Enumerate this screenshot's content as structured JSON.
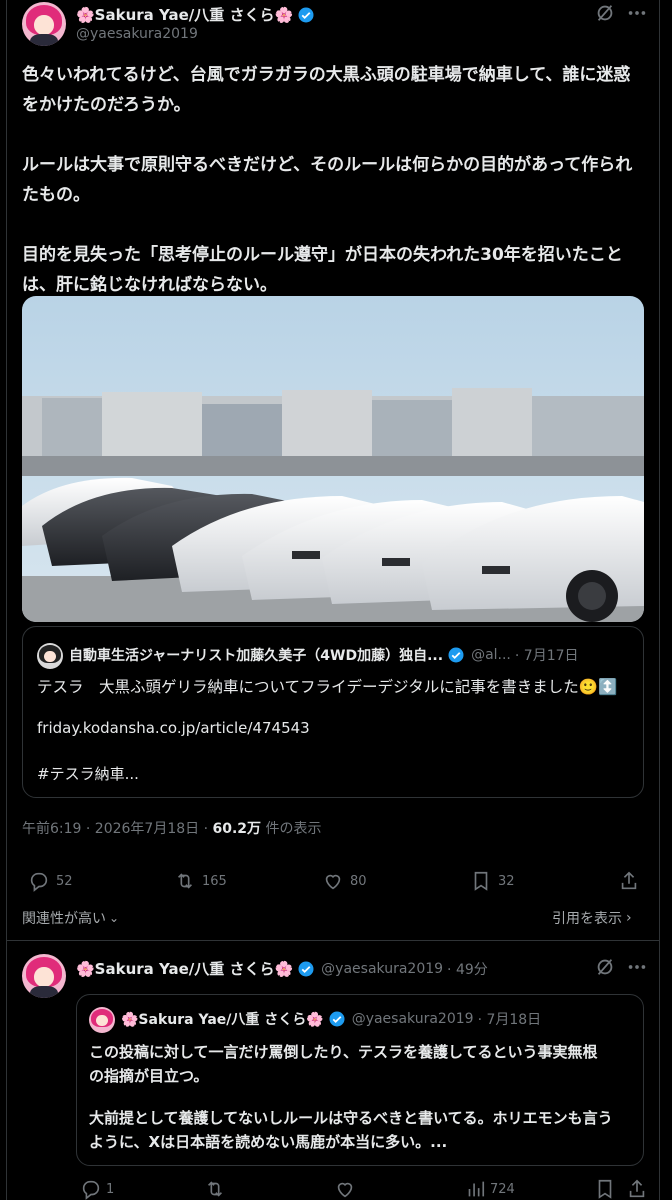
{
  "main_tweet": {
    "author_name": "🌸Sakura Yae/八重 さくら🌸",
    "handle": "@yaesakura2019",
    "paragraphs": [
      "色々いわれてるけど、台風でガラガラの大黒ふ頭の駐車場で納車して、誰に迷惑をかけたのだろうか。",
      "ルールは大事で原則守るべきだけど、そのルールは何らかの目的があって作られたもの。",
      "目的を見失った「思考停止のルール遵守」が日本の失われた30年を招いたことは、肝に銘じなければならない。"
    ],
    "timestamp": "午前6:19 · 2026年7月18日 · ",
    "views_count": "60.2万",
    "views_label": " 件の表示",
    "actions": {
      "replies": "52",
      "retweets": "165",
      "likes": "80",
      "bookmarks": "32"
    },
    "sort_label": "関連性が高い",
    "quotes_link": "引用を表示"
  },
  "quoted_tweet": {
    "author_name": "自動車生活ジャーナリスト加藤久美子（4WD加藤）独自...",
    "handle": "@al...",
    "date": "· 7月17日",
    "line1": "テスラ　大黒ふ頭ゲリラ納車についてフライデーデジタルに記事を書きました🙂↕️",
    "link": "friday.kodansha.co.jp/article/474543",
    "hashtag": "#テスラ納車..."
  },
  "reply_tweet": {
    "author_name": "🌸Sakura Yae/八重 さくら🌸",
    "handle": "@yaesakura2019",
    "time": "· 49分",
    "quoted": {
      "author_name": "🌸Sakura Yae/八重 さくら🌸",
      "handle": "@yaesakura2019",
      "date": "· 7月18日",
      "text_lines": [
        "この投稿に対して一言だけ罵倒したり、テスラを養護してるという事実無根",
        "の指摘が目立つ。",
        "",
        "大前提として養護してないしルールは守るべきと書いてる。ホリエモンも言う",
        "ように、Xは日本語を読めない馬鹿が本当に多い。..."
      ]
    },
    "actions": {
      "replies": "1",
      "retweets": "",
      "likes": "",
      "views": "724"
    }
  },
  "colors": {
    "background": "#000000",
    "text": "#e7e9ea",
    "muted": "#71767b",
    "verified": "#1d9bf0",
    "border": "#2f3336"
  }
}
